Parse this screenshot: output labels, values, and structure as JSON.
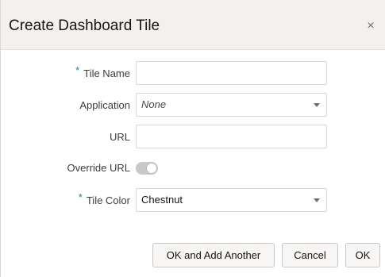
{
  "dialog": {
    "title": "Create Dashboard Tile",
    "close_glyph": "×"
  },
  "form": {
    "tile_name": {
      "label": "Tile Name",
      "required": true,
      "value": ""
    },
    "application": {
      "label": "Application",
      "value": "None"
    },
    "url": {
      "label": "URL",
      "value": ""
    },
    "override_url": {
      "label": "Override URL",
      "on": false
    },
    "tile_color": {
      "label": "Tile Color",
      "required": true,
      "value": "Chestnut"
    }
  },
  "required_marker": "*",
  "buttons": {
    "ok_add_another": "OK and Add Another",
    "cancel": "Cancel",
    "ok": "OK"
  }
}
